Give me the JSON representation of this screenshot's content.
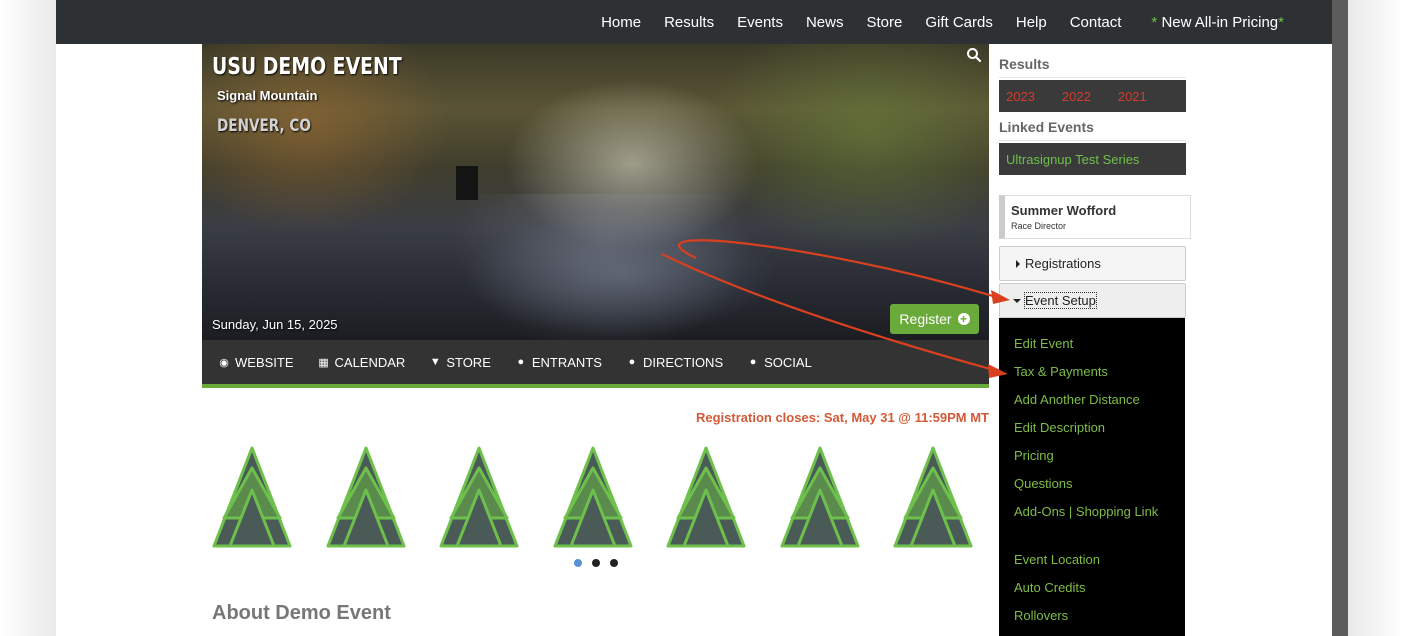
{
  "topnav": {
    "items": [
      "Home",
      "Results",
      "Events",
      "News",
      "Store",
      "Gift Cards",
      "Help",
      "Contact"
    ],
    "pricing_star": "*",
    "pricing_label": "New All-in Pricing"
  },
  "hero": {
    "title": "USU DEMO EVENT",
    "subtitle": "Signal Mountain",
    "location": "DENVER, CO",
    "date": "Sunday, Jun 15, 2025",
    "register_label": "Register"
  },
  "subnav": {
    "items": [
      {
        "label": "WEBSITE",
        "icon": "globe-icon"
      },
      {
        "label": "CALENDAR",
        "icon": "calendar-icon"
      },
      {
        "label": "STORE",
        "icon": "cart-icon"
      },
      {
        "label": "ENTRANTS",
        "icon": "users-icon"
      },
      {
        "label": "DIRECTIONS",
        "icon": "map-pin-icon"
      },
      {
        "label": "SOCIAL",
        "icon": "users-icon"
      }
    ]
  },
  "registration_closes": "Registration closes: Sat, May 31 @ 11:59PM MT",
  "carousel": {
    "slide_count": 3,
    "active_slide": 1,
    "tree_count": 7
  },
  "about_heading": "About Demo Event",
  "sidebar": {
    "results_heading": "Results",
    "years": [
      "2023",
      "2022",
      "2021"
    ],
    "linked_heading": "Linked Events",
    "linked_event": "Ultrasignup Test Series",
    "director_name": "Summer Wofford",
    "director_role": "Race Director",
    "registrations_label": "Registrations",
    "event_setup_label": "Event Setup",
    "menu_items": [
      "Edit Event",
      "Tax & Payments",
      "Add Another Distance",
      "Edit Description",
      "Pricing",
      "Questions",
      "Add-Ons | Shopping Link",
      "Event Location",
      "Auto Credits",
      "Rollovers"
    ]
  },
  "colors": {
    "topnav_bg": "#2e3133",
    "accent_green": "#6aaa3a",
    "menu_link_green": "#7dbd45",
    "year_red": "#d63b2c",
    "arrow_red": "#d8401f",
    "registration_orange": "#d35a38"
  }
}
